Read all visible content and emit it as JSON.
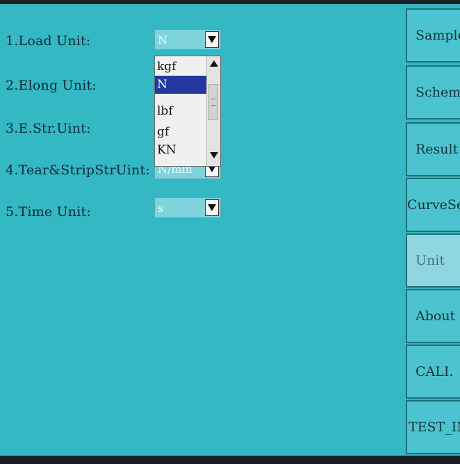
{
  "settings": {
    "rows": [
      {
        "label": "1.Load Unit:",
        "value": "N"
      },
      {
        "label": "2.Elong Unit:",
        "value": ""
      },
      {
        "label": "3.E.Str.Uint:",
        "value": ""
      },
      {
        "label": "4.Tear&StripStrUint:",
        "value": "N/mm"
      },
      {
        "label": "5.Time Unit:",
        "value": "s"
      }
    ]
  },
  "dropdown": {
    "options": [
      "kgf",
      "N",
      "lbf",
      "gf",
      "KN"
    ],
    "selected": "N"
  },
  "nav": {
    "items": [
      {
        "label": "Sample"
      },
      {
        "label": "Scheme"
      },
      {
        "label": "Result"
      },
      {
        "label": "CurveSet"
      },
      {
        "label": "Unit"
      },
      {
        "label": "About"
      },
      {
        "label": "CALI."
      },
      {
        "label": "TEST_INF"
      }
    ],
    "active": "Unit"
  },
  "colors": {
    "screen_bg": "#33b8c4",
    "selected_option": "#23379f",
    "active_nav": "#8fd6e0"
  }
}
